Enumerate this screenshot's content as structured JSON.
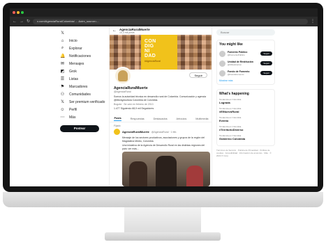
{
  "browser": {
    "url": "x.com/AgenciaRuralColombia/ ... &utm_source=..."
  },
  "profile_header": {
    "name": "AgenciaRuralMuerte",
    "posts": "10,3 mil posts"
  },
  "banner": {
    "line1": "CON",
    "line2": "DIG",
    "line3": "NI",
    "line4": "DAD",
    "tagline": "#AgenciaRural"
  },
  "profile": {
    "follow_label": "Seguir",
    "name": "AgenciaRuralMuerte",
    "handle": "@AgenciaRural",
    "bio": "Somos la autoridad técnica en desarrollo rural de Colombia. Comunicación y agencia @MinAgricultura Colombia de Colombia.",
    "meta": "Bogotá · Se unió en febrero de 2013",
    "counts": "1.477 Siguiendo   68,9 mil Seguidores"
  },
  "leftnav": {
    "items": [
      {
        "icon": "x-logo-icon",
        "glyph": "𝕏",
        "label": ""
      },
      {
        "icon": "home-icon",
        "glyph": "⌂",
        "label": "Inicio"
      },
      {
        "icon": "search-icon",
        "glyph": "⌕",
        "label": "Explorar"
      },
      {
        "icon": "bell-icon",
        "glyph": "🔔",
        "label": "Notificaciones"
      },
      {
        "icon": "mail-icon",
        "glyph": "✉",
        "label": "Mensajes"
      },
      {
        "icon": "grok-icon",
        "glyph": "◩",
        "label": "Grok"
      },
      {
        "icon": "list-icon",
        "glyph": "☰",
        "label": "Listas"
      },
      {
        "icon": "bookmark-icon",
        "glyph": "⚑",
        "label": "Marcadores"
      },
      {
        "icon": "people-icon",
        "glyph": "⚇",
        "label": "Comunidades"
      },
      {
        "icon": "x-premium-icon",
        "glyph": "𝕏",
        "label": "Ser premium verificado"
      },
      {
        "icon": "profile-icon",
        "glyph": "☺",
        "label": "Perfil"
      },
      {
        "icon": "more-icon",
        "glyph": "⋯",
        "label": "Más"
      }
    ],
    "post_label": "Postear"
  },
  "tabs": [
    {
      "label": "Posts",
      "active": true
    },
    {
      "label": "Respuestas",
      "active": false
    },
    {
      "label": "Destacados",
      "active": false
    },
    {
      "label": "Artículos",
      "active": false
    },
    {
      "label": "Multimedia",
      "active": false
    }
  ],
  "post": {
    "pinned": "Fijado",
    "author": "AgenciaRuralMuerte",
    "meta": "@AgenciaRural · 1 feb.",
    "text1": "Mensaje de los sectores productivos, asociaciones y grupos de la región del Magdalena Medio, Colombia.",
    "text2": "Una iniciativa de la Agencia de Desarrollo Rural en las distintas regiones del país: ver más..."
  },
  "right": {
    "search_placeholder": "Buscar",
    "suggest_title": "You might like",
    "suggestions": [
      {
        "name": "Fomento Público",
        "handle": "@FomentoPublico",
        "btn": "Seguir"
      },
      {
        "name": "Unidad de Restitución",
        "handle": "@URestitucion",
        "btn": "Seguir"
      },
      {
        "name": "Fondo de Fomento",
        "handle": "@FondoFomento",
        "btn": "Seguir"
      }
    ],
    "show_more": "Mostrar más",
    "trends_title": "What's happening",
    "trends": [
      {
        "cat": "Tendencia en Colombia",
        "name": "Lograda"
      },
      {
        "cat": "Tendencia en Colombia",
        "name": "#ElNuevoRural"
      },
      {
        "cat": "Tendencia en Colombia",
        "name": "Evento"
      },
      {
        "cat": "Tendencia en Colombia",
        "name": "#TerritorioDiverso"
      },
      {
        "cat": "Tendencia en Colombia",
        "name": "Gobierno Colombia"
      }
    ],
    "footer": "Términos de Servicio · Política de Privacidad · Política de cookies · Accesibilidad · Información de anuncios · Más · © 2024 X Corp."
  }
}
